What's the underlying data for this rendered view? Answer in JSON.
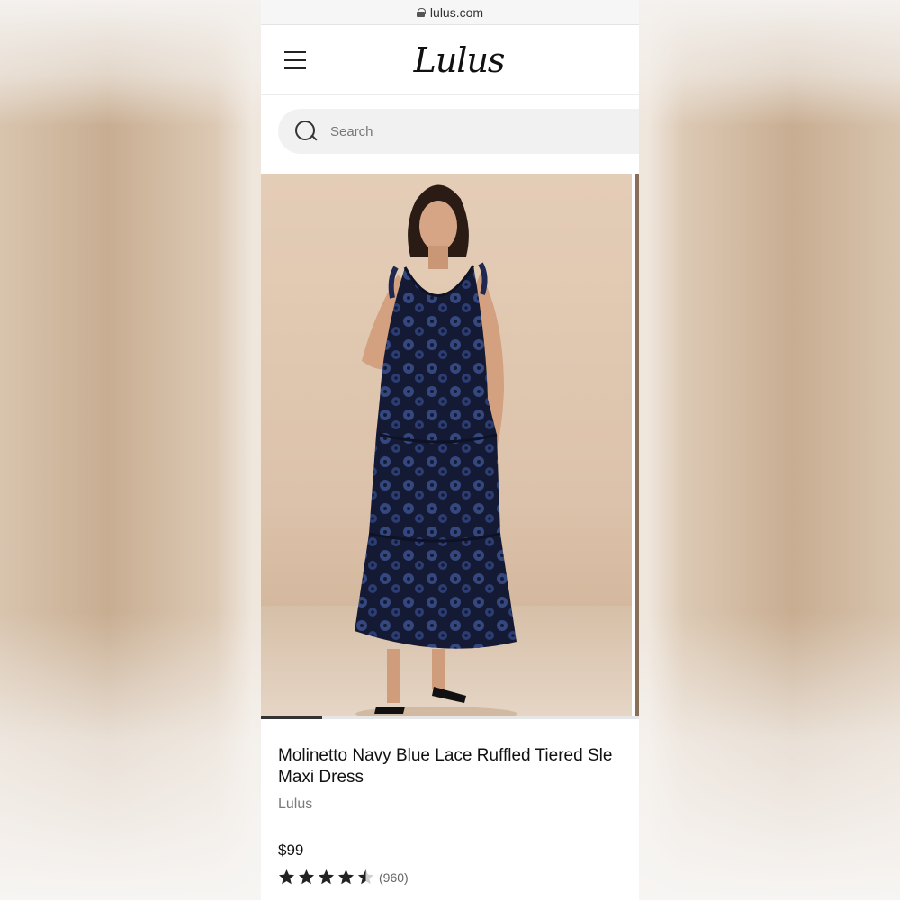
{
  "browser": {
    "url": "lulus.com"
  },
  "header": {
    "logo_text": "Lulus",
    "menu_icon": "hamburger-icon"
  },
  "search": {
    "placeholder": "Search",
    "value": ""
  },
  "gallery": {
    "active_index": 0
  },
  "product": {
    "title_line1": "Molinetto Navy Blue Lace Ruffled Tiered Sle",
    "title_line2": "Maxi Dress",
    "brand": "Lulus",
    "price": "$99",
    "rating": 4.5,
    "review_count": "(960)"
  },
  "colors": {
    "dress": "#1d2a55",
    "accent": "#3b4e8f",
    "background": "#e4cdb7"
  }
}
